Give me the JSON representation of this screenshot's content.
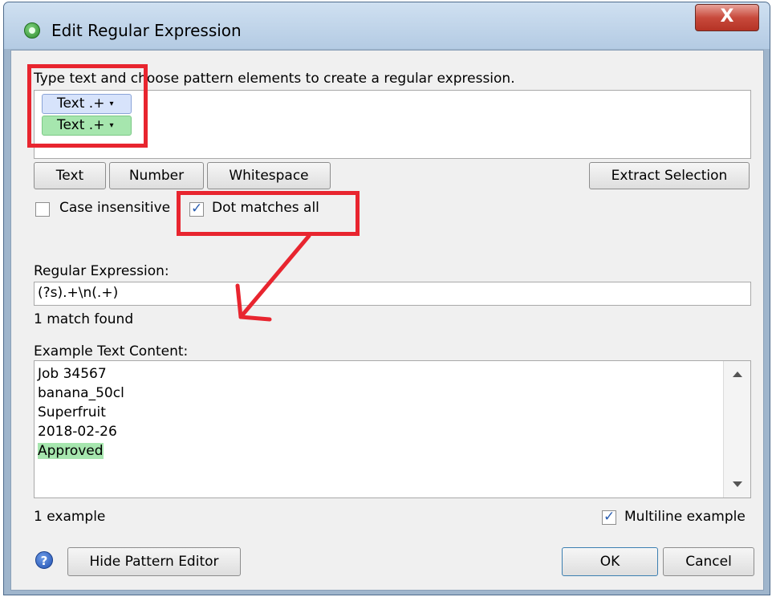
{
  "window": {
    "title": "Edit Regular Expression",
    "close_glyph": "X"
  },
  "pattern_editor": {
    "instructions": "Type text and choose pattern elements to create a regular expression.",
    "elements": [
      {
        "label": "Text .+",
        "color": "#d7e3fb"
      },
      {
        "label": "Text .+",
        "color": "#a6e6ae"
      }
    ],
    "dropdown_glyph": "▾",
    "buttons": {
      "text": "Text",
      "number": "Number",
      "whitespace": "Whitespace",
      "extract": "Extract Selection"
    },
    "options": {
      "case_insensitive": {
        "label": "Case insensitive",
        "checked": false
      },
      "dot_matches_all": {
        "label": "Dot matches all",
        "checked": true
      }
    }
  },
  "regex": {
    "label": "Regular Expression:",
    "value": "(?s).+\\n(.+)",
    "match_status": "1 match found"
  },
  "example": {
    "label": "Example Text Content:",
    "lines": [
      "Job 34567",
      "banana_50cl",
      "Superfruit",
      "2018-02-26",
      "Approved"
    ],
    "highlighted_line": "Approved",
    "highlight_color": "#a6e6ae",
    "count": "1 example",
    "multiline": {
      "label": "Multiline example",
      "checked": true
    }
  },
  "footer": {
    "help_glyph": "?",
    "hide_pattern_editor": "Hide Pattern Editor",
    "ok": "OK",
    "cancel": "Cancel"
  },
  "annotation_color": "#e8252f"
}
